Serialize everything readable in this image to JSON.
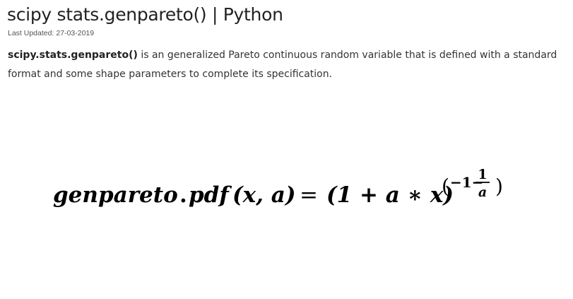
{
  "article": {
    "title": "scipy stats.genpareto() | Python",
    "last_updated_label": "Last Updated:",
    "last_updated_date": "27-03-2019",
    "intro_bold": "scipy.stats.genpareto()",
    "intro_rest": "is an generalized Pareto continuous random variable that is defined with a standard format and some shape parameters to complete its specification."
  },
  "formula": {
    "lhs_fn": "genpareto",
    "dot": ".",
    "lhs_method": "pdf",
    "lhs_args": "(x, a)",
    "equals": "=",
    "rhs_base": "(1 + a ∗ x)",
    "exp_open": "(",
    "exp_minus_one": "−1−",
    "exp_numerator": "1",
    "exp_denominator": "a",
    "exp_close": ")"
  }
}
